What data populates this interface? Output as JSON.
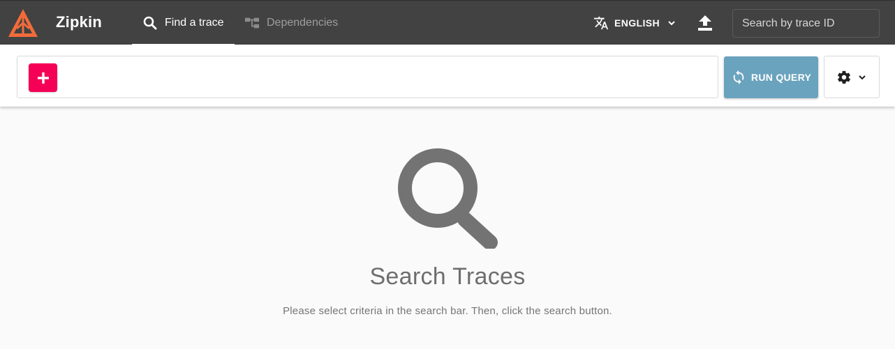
{
  "app": {
    "brand": "Zipkin",
    "logo_icon": "zipkin-logo-icon"
  },
  "nav": {
    "tabs": [
      {
        "label": "Find a trace",
        "icon": "search-icon",
        "active": true
      },
      {
        "label": "Dependencies",
        "icon": "tree-icon",
        "active": false
      }
    ]
  },
  "header": {
    "language_label": "ENGLISH",
    "language_icon": "translate-icon",
    "upload_icon": "upload-icon",
    "trace_search": {
      "placeholder": "Search by trace ID",
      "value": ""
    }
  },
  "toolbar": {
    "add_criteria_icon": "plus-icon",
    "run_query_label": "RUN QUERY",
    "run_query_icon": "sync-icon",
    "settings_icon": "gear-icon"
  },
  "empty_state": {
    "icon": "search-icon",
    "title": "Search Traces",
    "subtitle": "Please select criteria in the search bar. Then, click the search button."
  },
  "colors": {
    "appbar": "#424242",
    "accent_pink": "#f50057",
    "run_query": "#6aa3be",
    "logo_orange": "#f26b3a"
  }
}
